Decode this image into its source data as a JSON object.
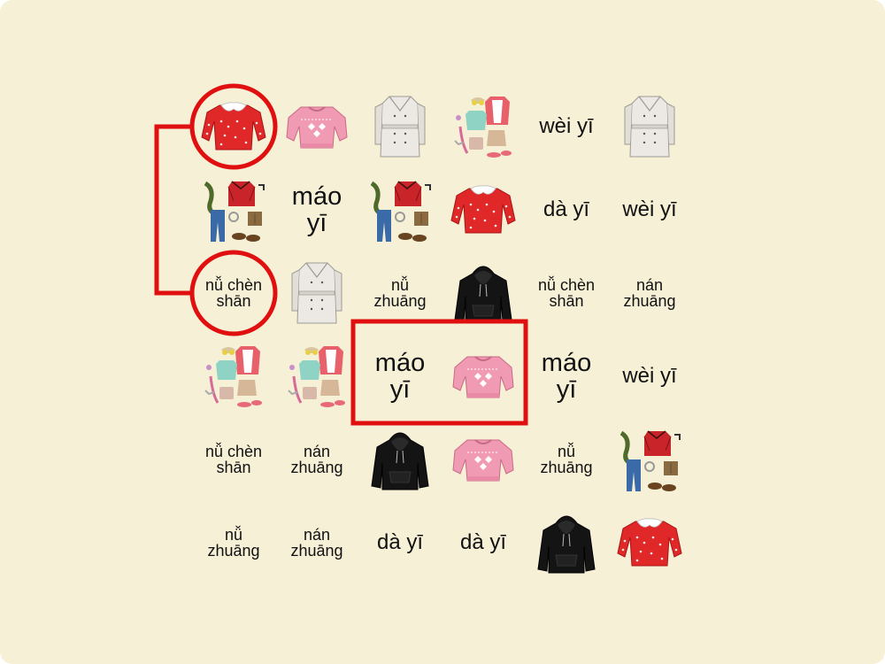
{
  "game": {
    "cells": [
      {
        "kind": "image",
        "icon": "red-blouse-icon"
      },
      {
        "kind": "image",
        "icon": "pink-sweater-icon"
      },
      {
        "kind": "image",
        "icon": "trench-coat-icon"
      },
      {
        "kind": "image",
        "icon": "womens-outfit-icon"
      },
      {
        "kind": "text",
        "text": "wèi yī",
        "size": "medium"
      },
      {
        "kind": "image",
        "icon": "trench-coat-icon"
      },
      {
        "kind": "image",
        "icon": "mens-outfit-icon"
      },
      {
        "kind": "text",
        "text": "máo yī",
        "size": "large"
      },
      {
        "kind": "image",
        "icon": "mens-outfit-icon"
      },
      {
        "kind": "image",
        "icon": "red-blouse-icon"
      },
      {
        "kind": "text",
        "text": "dà yī",
        "size": "medium"
      },
      {
        "kind": "text",
        "text": "wèi yī",
        "size": "medium"
      },
      {
        "kind": "text",
        "text": "nǚ chèn shān",
        "size": "small"
      },
      {
        "kind": "image",
        "icon": "trench-coat-icon"
      },
      {
        "kind": "text",
        "text": "nǚ zhuāng",
        "size": "small"
      },
      {
        "kind": "image",
        "icon": "black-hoodie-icon"
      },
      {
        "kind": "text",
        "text": "nǚ chèn shān",
        "size": "small"
      },
      {
        "kind": "text",
        "text": "nán zhuāng",
        "size": "small"
      },
      {
        "kind": "image",
        "icon": "womens-outfit-icon"
      },
      {
        "kind": "image",
        "icon": "womens-outfit-icon"
      },
      {
        "kind": "text",
        "text": "máo yī",
        "size": "large"
      },
      {
        "kind": "image",
        "icon": "pink-sweater-icon"
      },
      {
        "kind": "text",
        "text": "máo yī",
        "size": "large"
      },
      {
        "kind": "text",
        "text": "wèi yī",
        "size": "medium"
      },
      {
        "kind": "text",
        "text": "nǚ chèn shān",
        "size": "small"
      },
      {
        "kind": "text",
        "text": "nán zhuāng",
        "size": "small"
      },
      {
        "kind": "image",
        "icon": "black-hoodie-icon"
      },
      {
        "kind": "image",
        "icon": "pink-sweater-icon"
      },
      {
        "kind": "text",
        "text": "nǚ zhuāng",
        "size": "small"
      },
      {
        "kind": "image",
        "icon": "mens-outfit-icon"
      },
      {
        "kind": "text",
        "text": "nǚ zhuāng",
        "size": "small"
      },
      {
        "kind": "text",
        "text": "nán zhuāng",
        "size": "small"
      },
      {
        "kind": "text",
        "text": "dà yī",
        "size": "medium"
      },
      {
        "kind": "text",
        "text": "dà yī",
        "size": "medium"
      },
      {
        "kind": "image",
        "icon": "black-hoodie-icon"
      },
      {
        "kind": "image",
        "icon": "red-blouse-icon"
      }
    ],
    "matched_pair": {
      "cells": [
        0,
        12
      ],
      "color": "#e01010"
    },
    "selection": {
      "cells": [
        20,
        21
      ],
      "color": "#e01010"
    }
  },
  "colors": {
    "background": "#f6f0d6",
    "highlight": "#e01010"
  }
}
